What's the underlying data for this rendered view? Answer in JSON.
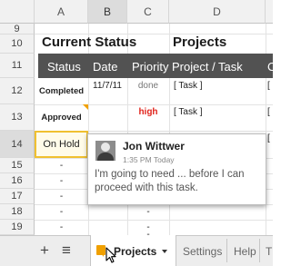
{
  "columns": [
    {
      "letter": "A",
      "selected": false
    },
    {
      "letter": "B",
      "selected": true
    },
    {
      "letter": "C",
      "selected": false
    },
    {
      "letter": "D",
      "selected": false
    },
    {
      "letter": "",
      "selected": false
    }
  ],
  "rows": [
    "9",
    "10",
    "11",
    "12",
    "13",
    "14",
    "15",
    "16",
    "17",
    "18",
    "19"
  ],
  "sections": {
    "current_status": "Current Status",
    "projects": "Projects"
  },
  "table_header": {
    "status": "Status",
    "date": "Date",
    "priority": "Priority",
    "project_task": "Project / Task",
    "extra": "C"
  },
  "data_rows": [
    {
      "status": "Completed",
      "date": "11/7/11",
      "priority": "done",
      "task": "[ Task ]",
      "extra": "["
    },
    {
      "status": "Approved",
      "date": "",
      "priority": "high",
      "task": "[ Task ]",
      "extra": "["
    },
    {
      "status": "On Hold",
      "date": "",
      "priority": "",
      "task": "",
      "extra": "["
    }
  ],
  "dashes": [
    "-",
    "-",
    "-",
    "-",
    "-"
  ],
  "priority_dashes": [
    "-",
    "-",
    "-",
    "-"
  ],
  "comment": {
    "author": "Jon Wittwer",
    "time": "1:35 PM Today",
    "text": "I'm going to need ... before I can proceed with this task."
  },
  "sheet_bar": {
    "add_icon": "+",
    "list_icon": "≡",
    "tabs": [
      "Projects",
      "Settings",
      "Help",
      "T"
    ]
  },
  "colors": {
    "header_bar": "#525252",
    "priority_high": "#e0231b",
    "comment_marker": "#f0a000"
  }
}
